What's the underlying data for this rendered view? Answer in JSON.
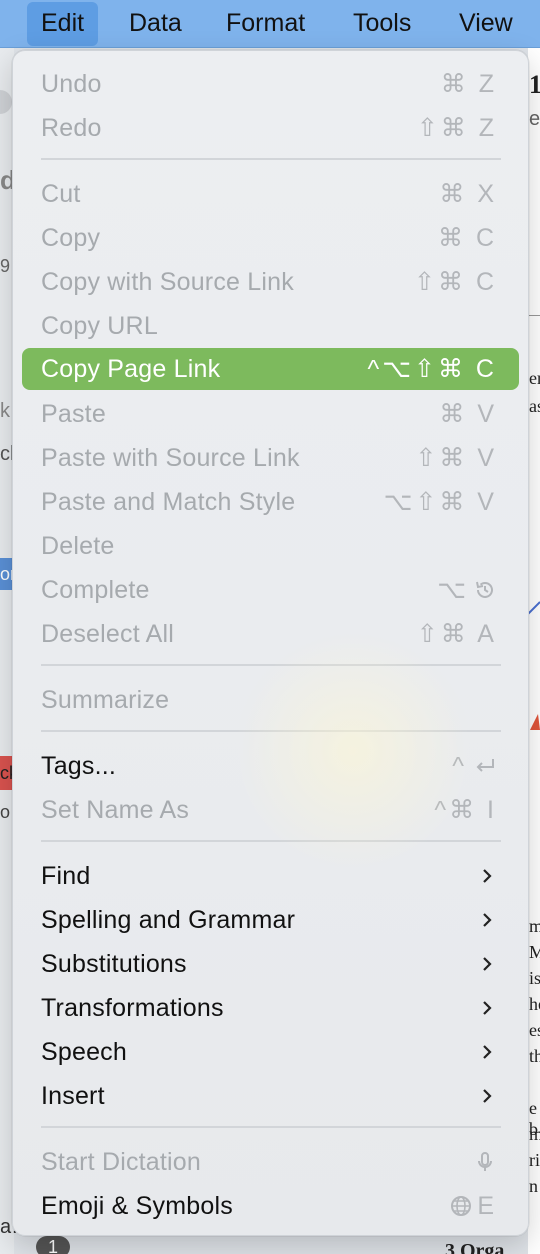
{
  "menubar": {
    "items": [
      "Edit",
      "Data",
      "Format",
      "Tools",
      "View"
    ],
    "active": "Edit"
  },
  "background": {
    "fragments": [
      "1",
      "e",
      "d",
      "9",
      "er",
      "as",
      "k",
      "ch",
      "or",
      "ck",
      "o",
      "m",
      "M",
      "is",
      "he",
      "es",
      "th",
      "e b",
      "m",
      "ri",
      "n",
      "a…",
      "1",
      "3 Orga"
    ]
  },
  "menu": {
    "items": [
      {
        "label": "Undo",
        "shortcut": "⌘ Z",
        "enabled": false
      },
      {
        "label": "Redo",
        "shortcut": "⇧⌘ Z",
        "enabled": false
      },
      {
        "label": "Cut",
        "shortcut": "⌘ X",
        "enabled": false
      },
      {
        "label": "Copy",
        "shortcut": "⌘ C",
        "enabled": false
      },
      {
        "label": "Copy with Source Link",
        "shortcut": "⇧⌘ C",
        "enabled": false
      },
      {
        "label": "Copy URL",
        "shortcut": "",
        "enabled": false
      },
      {
        "label": "Copy Page Link",
        "shortcut": "^⌥⇧⌘ C",
        "enabled": true,
        "highlighted": true
      },
      {
        "label": "Paste",
        "shortcut": "⌘ V",
        "enabled": false
      },
      {
        "label": "Paste with Source Link",
        "shortcut": "⇧⌘ V",
        "enabled": false
      },
      {
        "label": "Paste and Match Style",
        "shortcut": "⌥⇧⌘ V",
        "enabled": false
      },
      {
        "label": "Delete",
        "shortcut": "",
        "enabled": false
      },
      {
        "label": "Complete",
        "shortcut": "⌥",
        "shortcut_icon": "history-icon",
        "enabled": false
      },
      {
        "label": "Deselect All",
        "shortcut": "⇧⌘ A",
        "enabled": false
      },
      {
        "label": "Summarize",
        "shortcut": "",
        "enabled": false
      },
      {
        "label": "Tags...",
        "shortcut": "^",
        "shortcut_icon": "return-icon",
        "enabled": true
      },
      {
        "label": "Set Name As",
        "shortcut": "^⌘ I",
        "enabled": false
      },
      {
        "label": "Find",
        "submenu": true,
        "enabled": true
      },
      {
        "label": "Spelling and Grammar",
        "submenu": true,
        "enabled": true
      },
      {
        "label": "Substitutions",
        "submenu": true,
        "enabled": true
      },
      {
        "label": "Transformations",
        "submenu": true,
        "enabled": true
      },
      {
        "label": "Speech",
        "submenu": true,
        "enabled": true
      },
      {
        "label": "Insert",
        "submenu": true,
        "enabled": true
      },
      {
        "label": "Start Dictation",
        "shortcut": "",
        "shortcut_icon": "microphone-icon",
        "enabled": false
      },
      {
        "label": "Emoji & Symbols",
        "shortcut": "E",
        "shortcut_icon": "globe-icon",
        "enabled": true
      }
    ]
  },
  "colors": {
    "menubar": "#7fb3ec",
    "highlight": "#7dba5d",
    "disabled_text": "#a6aaae",
    "enabled_text": "#111111"
  }
}
